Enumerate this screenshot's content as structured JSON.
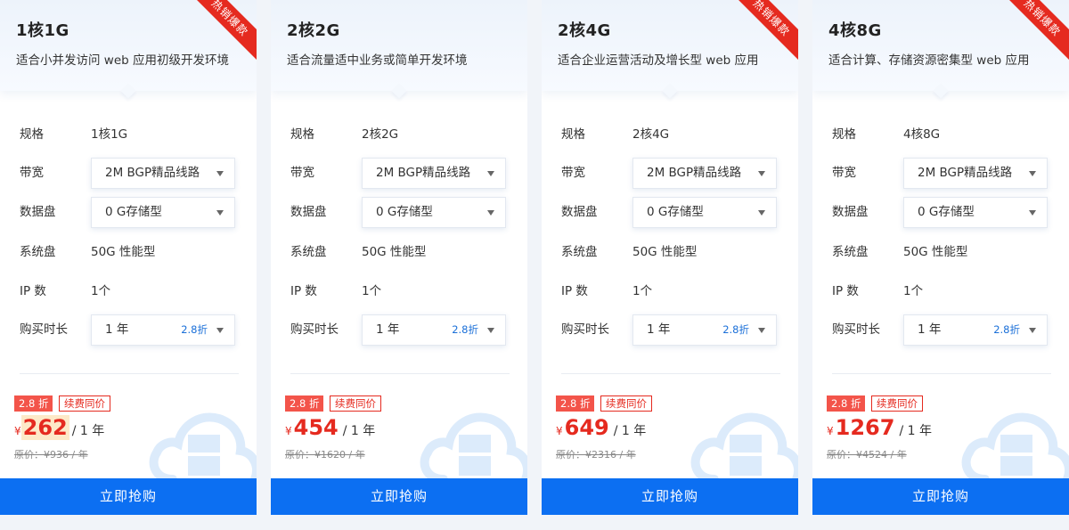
{
  "labels": {
    "spec": "规格",
    "bandwidth": "带宽",
    "data_disk": "数据盘",
    "system_disk": "系统盘",
    "ip": "IP 数",
    "duration": "购买时长",
    "buy": "立即抢购",
    "hot": "热销爆款",
    "renew": "续费同价",
    "currency": "¥",
    "per_year": "/ 1 年"
  },
  "colors": {
    "accent_blue": "#0c6ff2",
    "price_red": "#e52a1f",
    "ribbon_red": "#e52a1f",
    "discount_blue": "#1a6fd8"
  },
  "cards": [
    {
      "title": "1核1G",
      "desc": "适合小并发访问 web 应用初级开发环境",
      "hot": true,
      "spec": "1核1G",
      "bandwidth": "2M BGP精品线路",
      "data_disk": "0 G存储型",
      "system_disk": "50G 性能型",
      "ip": "1个",
      "duration": "1 年",
      "duration_discount": "2.8折",
      "discount_badge": "2.8 折",
      "price": "262",
      "price_highlight": true,
      "original": "原价：¥936 / 年"
    },
    {
      "title": "2核2G",
      "desc": "适合流量适中业务或简单开发环境",
      "hot": false,
      "spec": "2核2G",
      "bandwidth": "2M BGP精品线路",
      "data_disk": "0 G存储型",
      "system_disk": "50G 性能型",
      "ip": "1个",
      "duration": "1 年",
      "duration_discount": "2.8折",
      "discount_badge": "2.8 折",
      "price": "454",
      "price_highlight": false,
      "original": "原价：¥1620 / 年"
    },
    {
      "title": "2核4G",
      "desc": "适合企业运营活动及增长型 web 应用",
      "hot": true,
      "spec": "2核4G",
      "bandwidth": "2M BGP精品线路",
      "data_disk": "0 G存储型",
      "system_disk": "50G 性能型",
      "ip": "1个",
      "duration": "1 年",
      "duration_discount": "2.8折",
      "discount_badge": "2.8 折",
      "price": "649",
      "price_highlight": false,
      "original": "原价：¥2316 / 年"
    },
    {
      "title": "4核8G",
      "desc": "适合计算、存储资源密集型 web 应用",
      "hot": true,
      "spec": "4核8G",
      "bandwidth": "2M BGP精品线路",
      "data_disk": "0 G存储型",
      "system_disk": "50G 性能型",
      "ip": "1个",
      "duration": "1 年",
      "duration_discount": "2.8折",
      "discount_badge": "2.8 折",
      "price": "1267",
      "price_highlight": false,
      "original": "原价：¥4524 / 年"
    }
  ]
}
